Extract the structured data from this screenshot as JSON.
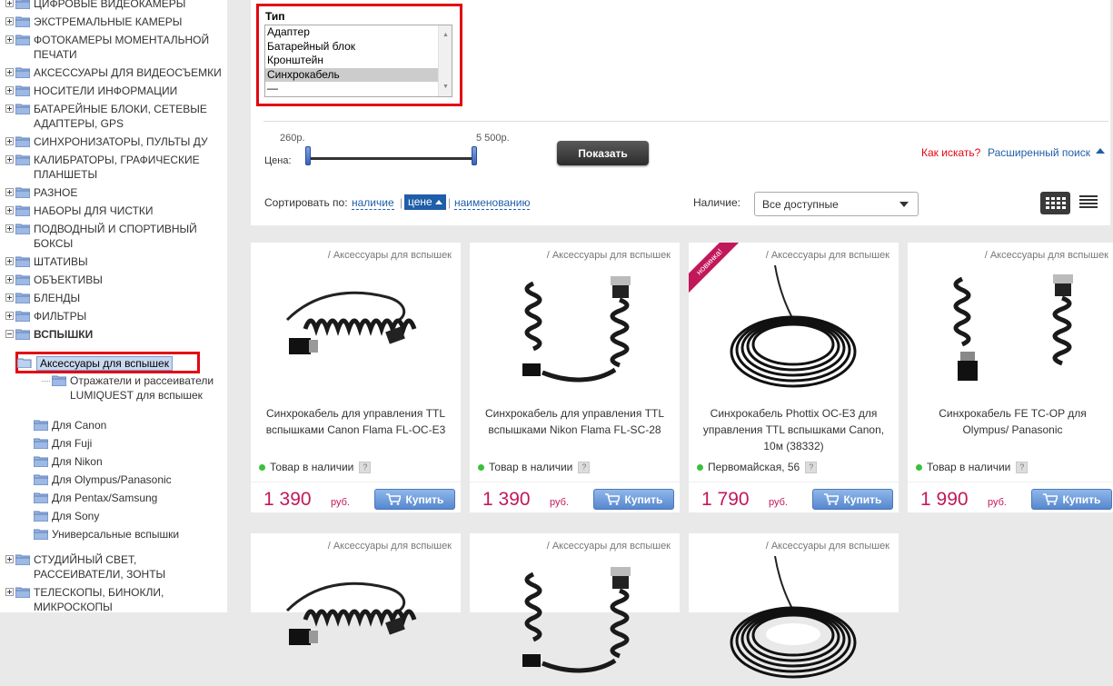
{
  "sidebar": {
    "items": [
      {
        "label": "ЦИФРОВЫЕ ВИДЕОКАМЕРЫ"
      },
      {
        "label": "ЭКСТРЕМАЛЬНЫЕ КАМЕРЫ"
      },
      {
        "label": "ФОТОКАМЕРЫ МОМЕНТАЛЬНОЙ",
        "label2": "ПЕЧАТИ"
      },
      {
        "label": "АКСЕССУАРЫ ДЛЯ ВИДЕОСЪЕМКИ"
      },
      {
        "label": "НОСИТЕЛИ ИНФОРМАЦИИ"
      },
      {
        "label": "БАТАРЕЙНЫЕ БЛОКИ, СЕТЕВЫЕ",
        "label2": "АДАПТЕРЫ, GPS"
      },
      {
        "label": "СИНХРОНИЗАТОРЫ, ПУЛЬТЫ ДУ"
      },
      {
        "label": "КАЛИБРАТОРЫ, ГРАФИЧЕСКИЕ",
        "label2": "ПЛАНШЕТЫ"
      },
      {
        "label": "РАЗНОЕ"
      },
      {
        "label": "НАБОРЫ ДЛЯ ЧИСТКИ"
      },
      {
        "label": "ПОДВОДНЫЙ И СПОРТИВНЫЙ",
        "label2": "БОКСЫ"
      },
      {
        "label": "ШТАТИВЫ"
      },
      {
        "label": "ОБЪЕКТИВЫ"
      },
      {
        "label": "БЛЕНДЫ"
      },
      {
        "label": "ФИЛЬТРЫ"
      },
      {
        "label": "ВСПЫШКИ"
      },
      {
        "label": "СТУДИЙНЫЙ СВЕТ,",
        "label2": "РАССЕИВАТЕЛИ, ЗОНТЫ"
      },
      {
        "label": "ТЕЛЕСКОПЫ, БИНОКЛИ,",
        "label2": "МИКРОСКОПЫ"
      }
    ],
    "active": "Аксессуары для вспышек",
    "sub": [
      {
        "label": "Отражатели и рассеиватели",
        "label2": "LUMIQUEST для вспышек"
      }
    ],
    "children": [
      {
        "label": "Для Canon"
      },
      {
        "label": "Для Fuji"
      },
      {
        "label": "Для Nikon"
      },
      {
        "label": "Для Olympus/Panasonic"
      },
      {
        "label": "Для Pentax/Samsung"
      },
      {
        "label": "Для Sony"
      },
      {
        "label": "Универсальные вспышки"
      }
    ]
  },
  "filter": {
    "type_label": "Тип",
    "type_options": [
      "Адаптер",
      "Батарейный блок",
      "Кронштейн",
      "Синхрокабель",
      "—"
    ],
    "type_selected": "Синхрокабель",
    "price_min": "260р.",
    "price_max": "5 500р.",
    "price_label": "Цена:",
    "price_range_selected_fraction": [
      0,
      1
    ],
    "show_button": "Показать",
    "how_search": "Как искать?",
    "advanced_search": "Расширенный поиск"
  },
  "sort": {
    "label": "Сортировать по:",
    "availability": "наличие",
    "price": "цене",
    "name": "наименованию",
    "sep": "|"
  },
  "availability": {
    "label": "Наличие:",
    "value": "Все доступные"
  },
  "products": [
    {
      "category": "/ Аксессуары для вспышек",
      "name": "Синхрокабель для управления TTL вспышками Canon Flama FL-OC-E3",
      "stock": "Товар в наличии",
      "price": "1 390",
      "currency": "руб.",
      "buy": "Купить"
    },
    {
      "category": "/ Аксессуары для вспышек",
      "name": "Синхрокабель для управления TTL вспышками Nikon Flama FL-SC-28",
      "stock": "Товар в наличии",
      "price": "1 390",
      "currency": "руб.",
      "buy": "Купить"
    },
    {
      "category": "/ Аксессуары для вспышек",
      "badge": "новинка!",
      "name": "Синхрокабель Phottix OC-E3 для управления TTL вспышками Canon, 10м (38332)",
      "stock": "Первомайская, 56",
      "price": "1 790",
      "currency": "руб.",
      "buy": "Купить"
    },
    {
      "category": "/ Аксессуары для вспышек",
      "name": "Синхрокабель FE TC-OP для Olympus/ Panasonic",
      "stock": "Товар в наличии",
      "price": "1 990",
      "currency": "руб.",
      "buy": "Купить"
    },
    {
      "category": "/ Аксессуары для вспышек"
    },
    {
      "category": "/ Аксессуары для вспышек"
    },
    {
      "category": "/ Аксессуары для вспышек"
    }
  ],
  "help_icon": "?",
  "colors": {
    "accent_red": "#e30613",
    "link_blue": "#1f5ea8",
    "price": "#c2185b",
    "in_stock": "#3cbf3c"
  }
}
